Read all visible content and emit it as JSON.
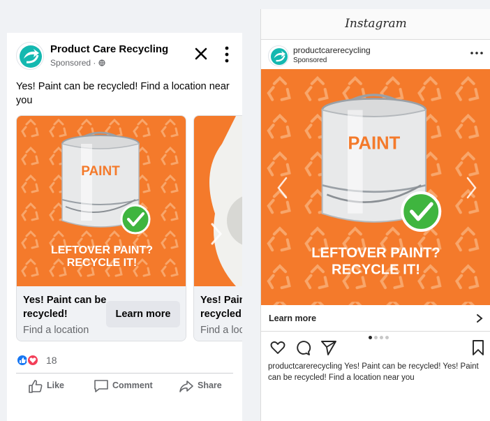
{
  "facebook": {
    "page_name": "Product Care Recycling",
    "sponsored_label": "Sponsored · ",
    "post_text": "Yes! Paint can be recycled! Find a location near you",
    "slides": [
      {
        "headline": "Yes! Paint can be recycled!",
        "description": "Find a location",
        "button": "Learn more"
      },
      {
        "headline": "Yes! Paint can be recycled!",
        "description": "Find a location"
      }
    ],
    "reaction_count": "18",
    "actions": {
      "like": "Like",
      "comment": "Comment",
      "share": "Share"
    }
  },
  "instagram": {
    "logo": "Instagram",
    "username": "productcarerecycling",
    "sponsored_label": "Sponsored",
    "cta": "Learn more",
    "caption_user": "productcarerecycling",
    "caption_text": " Yes! Paint can be recycled! Yes! Paint can be recycled! Find a location near you",
    "carousel_dots": 4,
    "active_dot": 1
  },
  "creative": {
    "can_label": "PAINT",
    "headline_line1": "LEFTOVER PAINT?",
    "headline_line2": "RECYCLE IT!"
  },
  "colors": {
    "brand_orange": "#f47a2b",
    "pattern_orange": "#f8a66b",
    "check_green": "#3fb53f",
    "brand_teal": "#14b8b0",
    "like_blue": "#1877f2",
    "love_red": "#f33e58"
  }
}
